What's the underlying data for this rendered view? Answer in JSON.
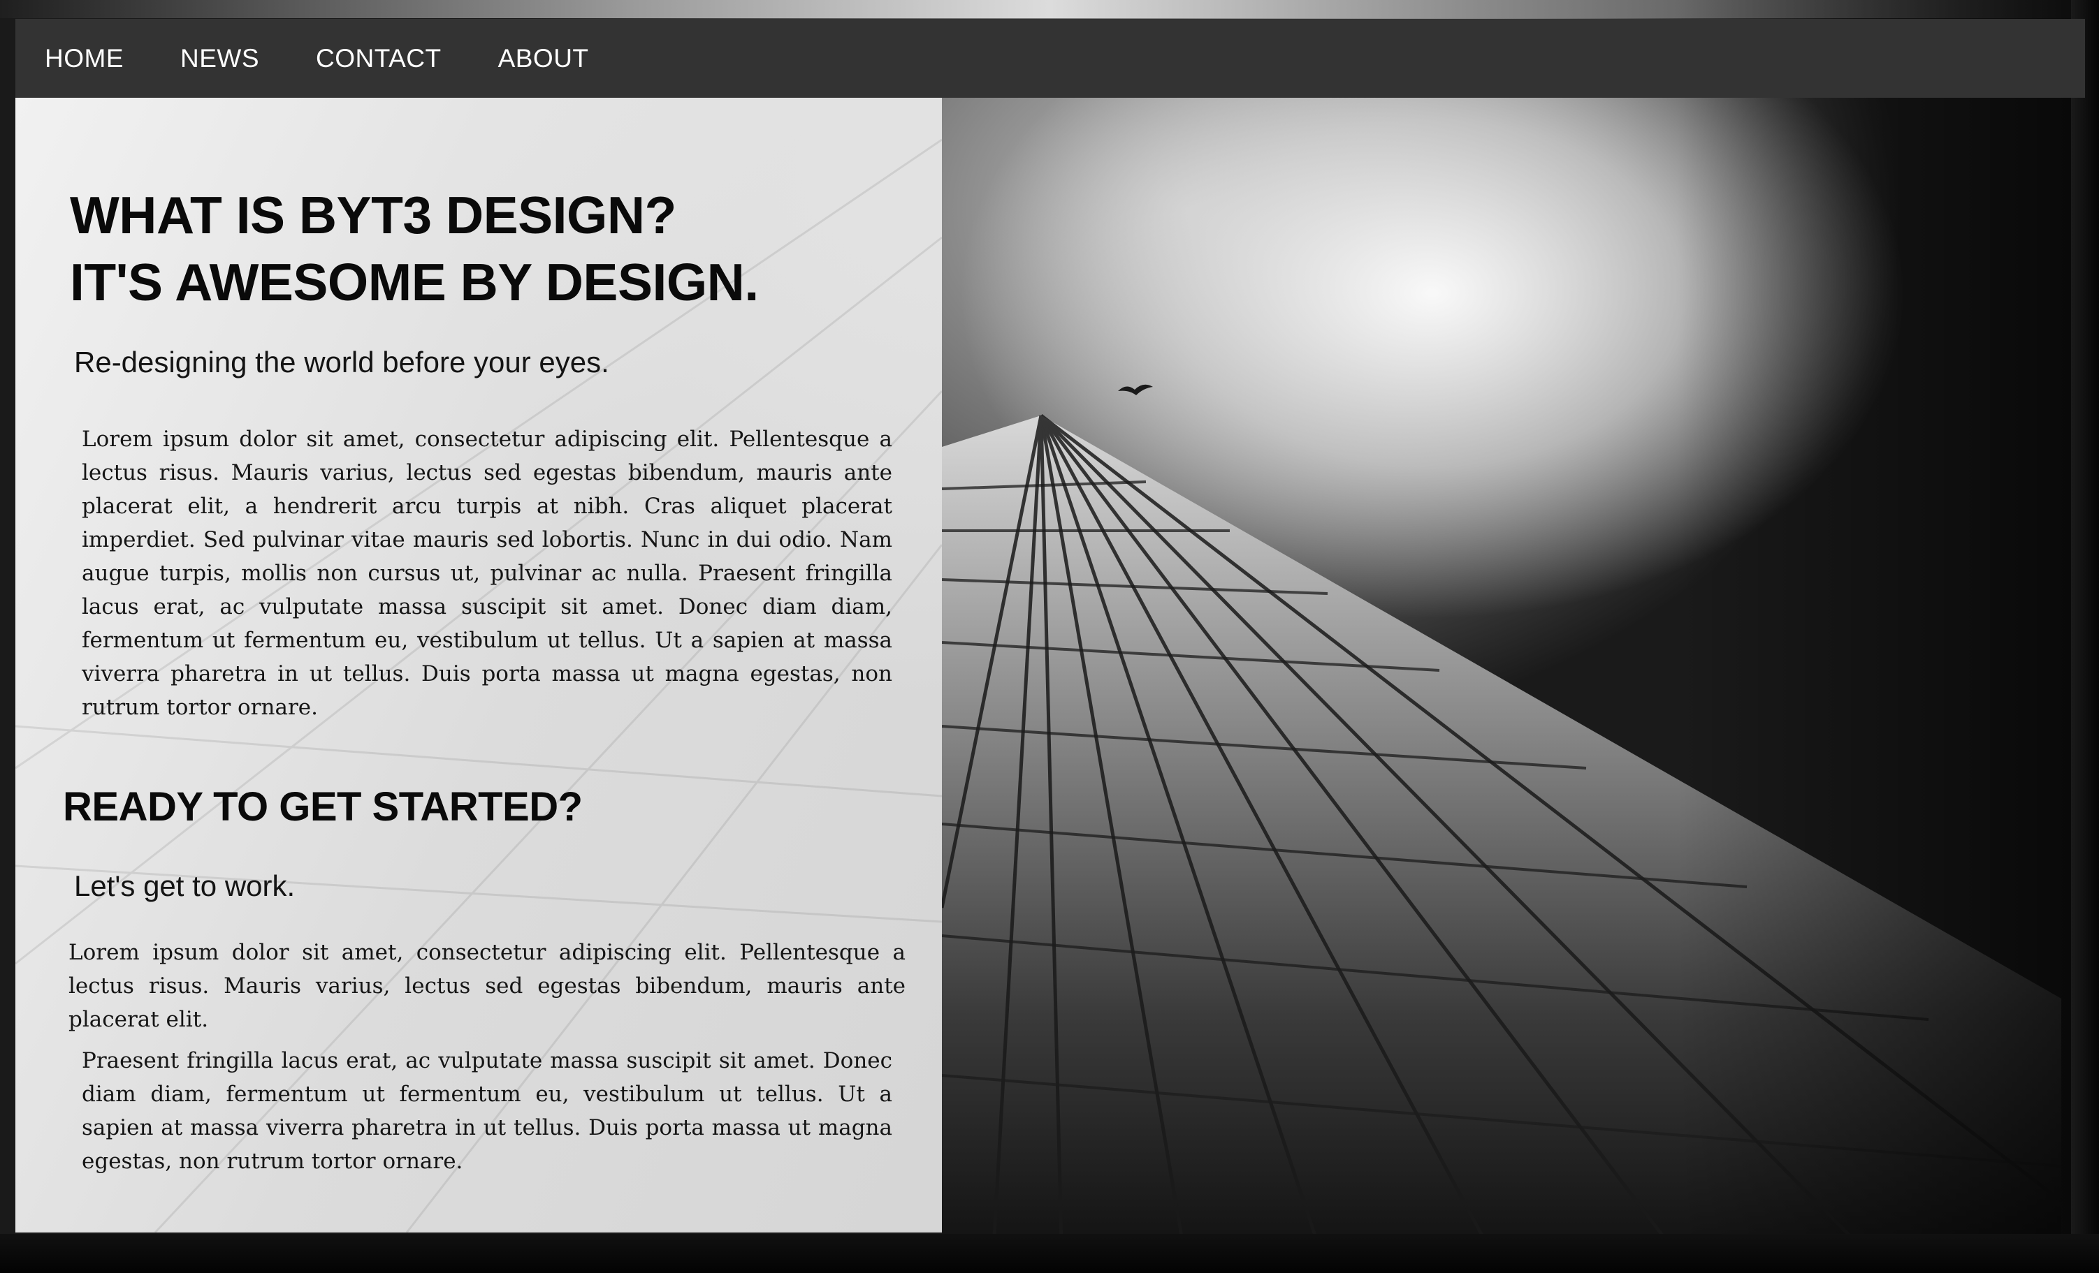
{
  "nav": {
    "items": [
      "HOME",
      "NEWS",
      "CONTACT",
      "ABOUT"
    ]
  },
  "hero": {
    "title_line1": "WHAT IS BYT3 DESIGN?",
    "title_line2": "IT'S AWESOME BY DESIGN.",
    "subtitle": "Re-designing the world before your eyes.",
    "paragraph": "Lorem ipsum dolor sit amet, consectetur adipiscing elit. Pellentesque a lectus risus. Mauris varius, lectus sed egestas bibendum, mauris ante placerat elit, a hendrerit arcu turpis at nibh. Cras aliquet placerat imperdiet. Sed pulvinar vitae mauris sed lobortis. Nunc in dui odio. Nam augue turpis, mollis non cursus ut, pulvinar ac nulla. Praesent fringilla lacus erat, ac vulputate massa suscipit sit amet. Donec diam diam, fermentum ut fermentum eu, vestibulum ut tellus. Ut a sapien at massa viverra pharetra in ut tellus. Duis porta massa ut magna egestas, non rutrum tortor ornare."
  },
  "cta": {
    "title": "READY TO GET STARTED?",
    "subtitle": "Let's get to work.",
    "paragraph1": "Lorem ipsum dolor sit amet, consectetur adipiscing elit. Pellentesque a lectus risus. Mauris varius, lectus sed egestas bibendum, mauris ante placerat elit.",
    "paragraph2": "Praesent fringilla lacus erat, ac vulputate massa suscipit sit amet. Donec diam diam, fermentum ut fermentum eu, vestibulum ut tellus. Ut a sapien at massa viverra pharetra in ut tellus. Duis porta massa ut magna egestas, non rutrum tortor ornare."
  },
  "colors": {
    "navbar": "#333333",
    "nav_text": "#ffffff",
    "panel": "#efefef",
    "text": "#0a0a0a"
  },
  "icons": {
    "background": "skyscraper-photo",
    "bird": "bird-icon"
  }
}
